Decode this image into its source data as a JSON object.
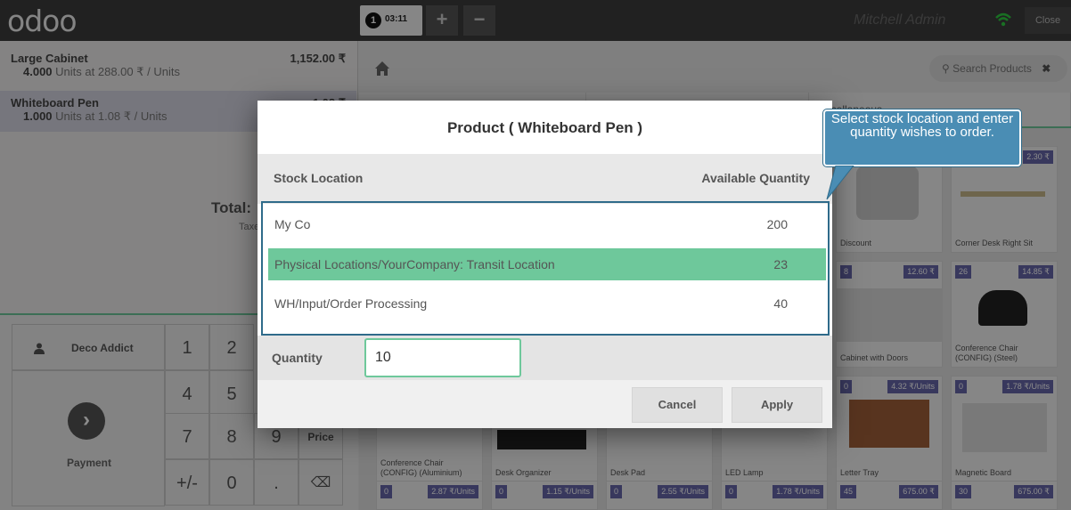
{
  "topbar": {
    "logo": "odoo",
    "order_number": "1",
    "order_time": "03:11",
    "add_label": "+",
    "remove_label": "−",
    "user_name": "Mitchell Admin",
    "close_label": "Close"
  },
  "orderlines": [
    {
      "name": "Large Cabinet",
      "qty": "4.000",
      "detail": "Units at 288.00 ₹ / Units",
      "price": "1,152.00 ₹"
    },
    {
      "name": "Whiteboard Pen",
      "qty": "1.000",
      "detail": "Units at 1.08 ₹ / Units",
      "price": "1.08 ₹"
    }
  ],
  "summary": {
    "total_label": "Total:",
    "taxes_label": "Taxes:"
  },
  "numpad": {
    "customer": "Deco Addict",
    "payment_label": "Payment",
    "keys": [
      "1",
      "2",
      "4",
      "5",
      "7",
      "8",
      "9",
      "Price",
      "+/-",
      "0",
      "."
    ],
    "backspace": "⌫"
  },
  "products_header": {
    "search_placeholder": "Search Products",
    "clear": "✖",
    "categories": [
      "",
      "",
      "Miscellaneous"
    ]
  },
  "products": [
    {
      "name": "Discount",
      "tag": ""
    },
    {
      "name": "Corner Desk Right Sit",
      "tag": "2.30 ₹"
    },
    {
      "name": "Cabinet with Doors",
      "qty": "8",
      "tag": "12.60 ₹"
    },
    {
      "name": "Conference Chair (CONFIG) (Steel)",
      "qty": "26",
      "tag": "14.85 ₹"
    },
    {
      "name": "Conference Chair (CONFIG) (Aluminium)",
      "tag": ""
    },
    {
      "name": "Desk Organizer",
      "tag": ""
    },
    {
      "name": "Desk Pad",
      "tag": ""
    },
    {
      "name": "LED Lamp",
      "tag": ""
    },
    {
      "name": "Letter Tray",
      "qty": "0",
      "tag": "4.32 ₹/Units"
    },
    {
      "name": "Magnetic Board",
      "qty": "0",
      "tag": "1.78 ₹/Units"
    },
    {
      "qty": "0",
      "tag": "2.87 ₹/Units"
    },
    {
      "qty": "0",
      "tag": "1.15 ₹/Units"
    },
    {
      "qty": "0",
      "tag": "2.55 ₹/Units"
    },
    {
      "qty": "0",
      "tag": "1.78 ₹/Units"
    },
    {
      "qty": "45",
      "tag": "675.00 ₹"
    },
    {
      "qty": "30",
      "tag": "675.00 ₹"
    }
  ],
  "modal": {
    "title": "Product ( Whiteboard Pen )",
    "col_location": "Stock Location",
    "col_qty": "Available Quantity",
    "rows": [
      {
        "location": "My Co",
        "qty": "200"
      },
      {
        "location": "Physical Locations/YourCompany: Transit Location",
        "qty": "23"
      },
      {
        "location": "WH/Input/Order Processing",
        "qty": "40"
      }
    ],
    "selected_row": 1,
    "quantity_label": "Quantity",
    "quantity_value": "10",
    "cancel_label": "Cancel",
    "apply_label": "Apply"
  },
  "callout": {
    "text": "Select stock location and enter quantity wishes to order."
  },
  "colors": {
    "accent_green": "#6ec89b",
    "callout_blue": "#4a8db4",
    "topbar": "#3c3c3c"
  }
}
